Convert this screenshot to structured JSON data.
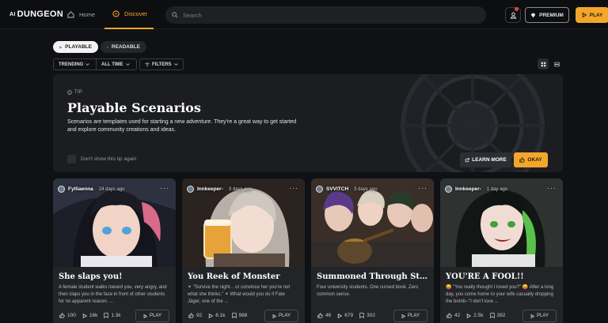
{
  "nav": {
    "logo": "DUNGEON",
    "logo_prefix": "AI",
    "home_label": "Home",
    "discover_label": "Discover",
    "search_placeholder": "Search",
    "premium_label": "PREMIUM",
    "play_label": "PLAY"
  },
  "modes": {
    "playable": "PLAYABLE",
    "readable": "READABLE",
    "active": "PLAYABLE"
  },
  "filters": {
    "trending": "TRENDING",
    "time": "ALL TIME",
    "filters": "FILTERS"
  },
  "tip": {
    "tag": "TIP",
    "title": "Playable Scenarios",
    "description": "Scenarios are templates used for starting a new adventure. They're a great way to get started and explore community creations and ideas.",
    "dont_show": "Don't show this tip again",
    "learn_more": "LEARN MORE",
    "okay": "OKAY"
  },
  "cards": [
    {
      "author": "Fylliaenna",
      "ago": "24 days ago",
      "title": "She slaps you!",
      "description": "A female student walks toward you, very angry, and then slaps you in the face in front of other students for no apparent reason. ...",
      "likes": "100",
      "plays": "16k",
      "saves": "1.3k",
      "play": "PLAY"
    },
    {
      "author": "Innkeeper-",
      "ago": "3 days ago",
      "title": "You Reek of Monster",
      "description": "✴ \"Survive the night... or convince her you're not what she thinks.\" ✴ What would you do if Fate Jäger, one of the ...",
      "likes": "92",
      "plays": "6.1k",
      "saves": "988",
      "play": "PLAY"
    },
    {
      "author": "SVVITCH",
      "ago": "3 days ago",
      "title": "Summoned Through Stupidity",
      "description": "Four university students. One cursed book. Zero common sense.",
      "likes": "46",
      "plays": "679",
      "saves": "302",
      "play": "PLAY"
    },
    {
      "author": "Innkeeper-",
      "ago": "1 day ago",
      "title": "YOU'RE A FOOL!!",
      "description": "😛 \"You really thought I loved you?\" 😛 After a long day, you come home to your wife casually dropping the bomb--\"I don't love ...",
      "likes": "42",
      "plays": "2.5k",
      "saves": "392",
      "play": "PLAY"
    }
  ],
  "colors": {
    "accent": "#f4a62a",
    "background": "#101114",
    "card": "#222428"
  }
}
